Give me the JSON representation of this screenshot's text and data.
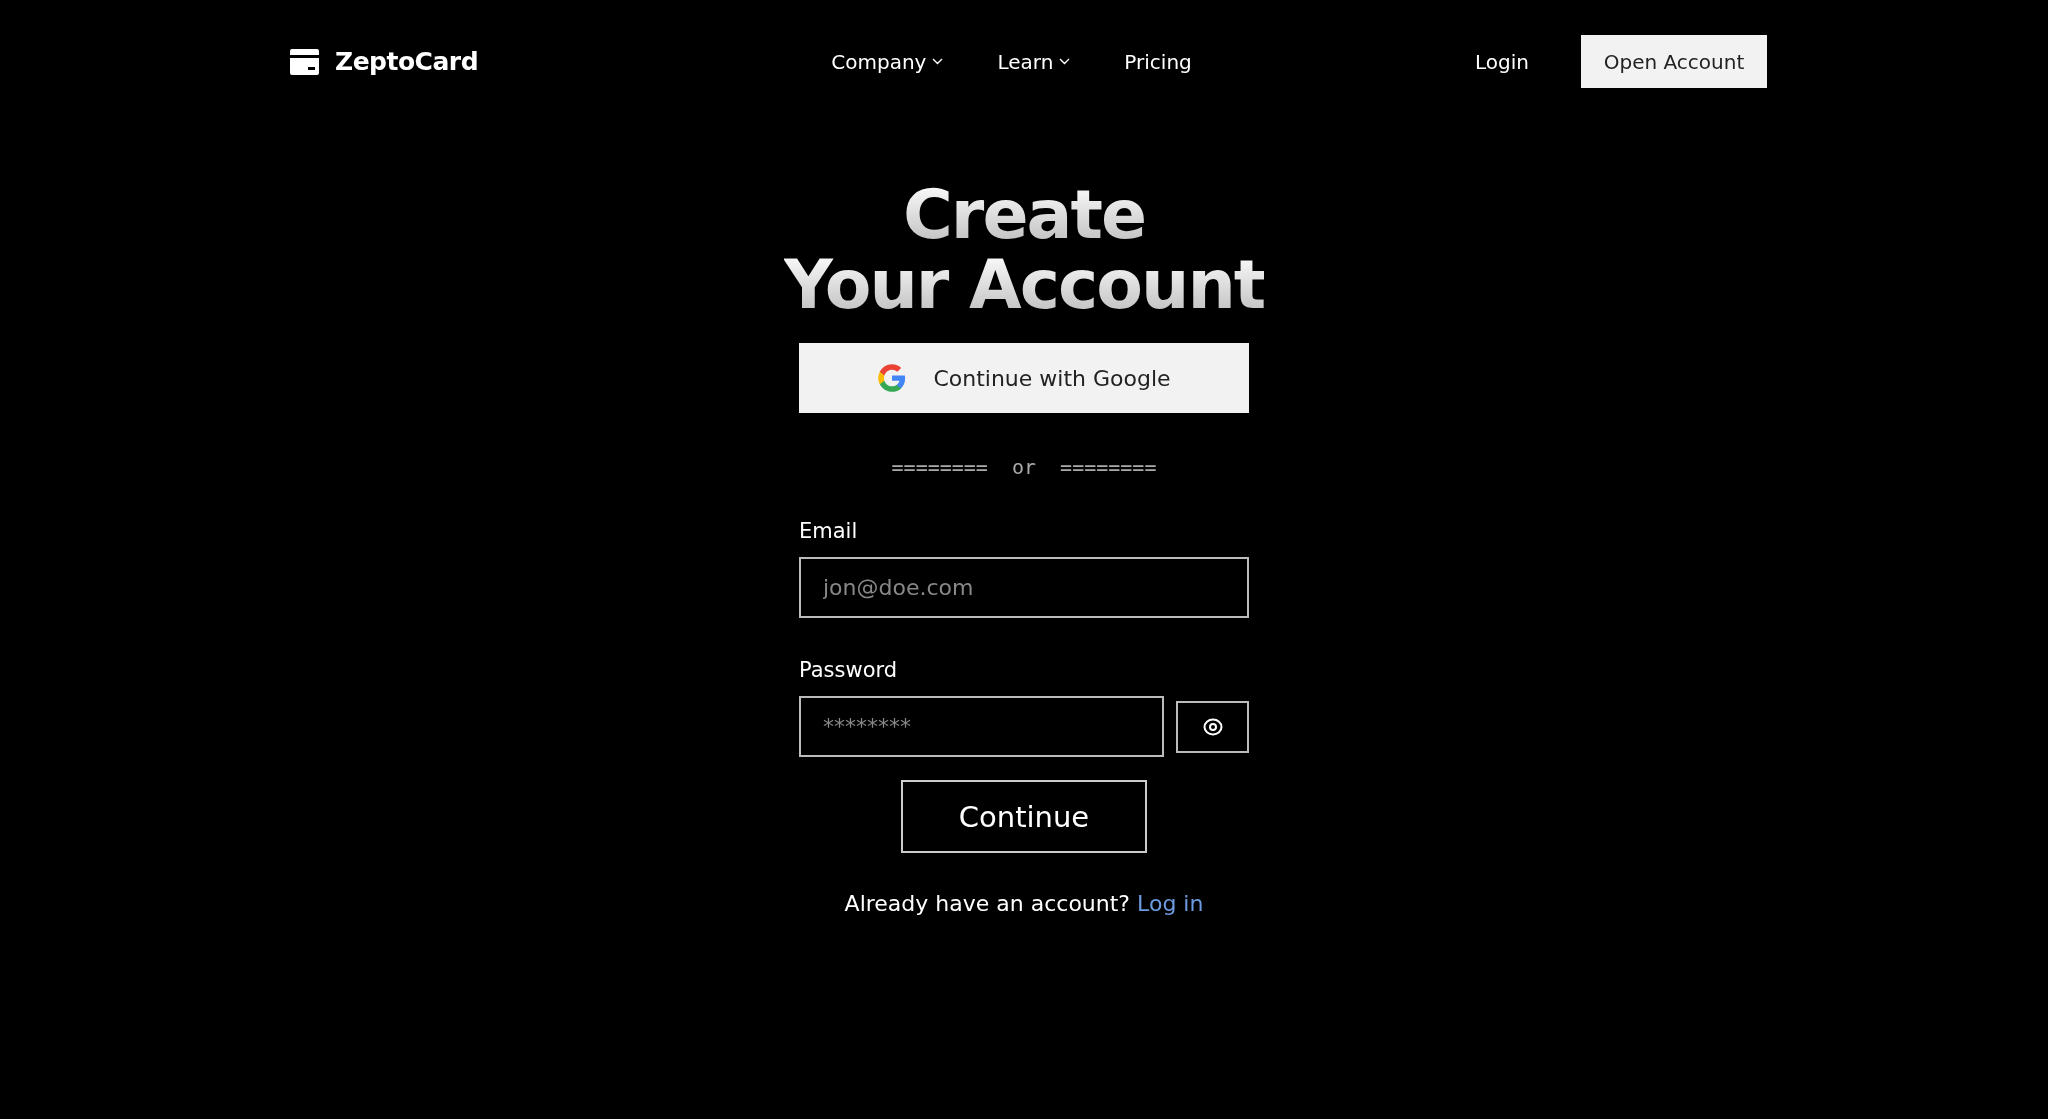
{
  "brand": {
    "name": "ZeptoCard"
  },
  "nav": [
    {
      "label": "Company",
      "kind": "dropdown"
    },
    {
      "label": "Learn",
      "kind": "dropdown"
    },
    {
      "label": "Pricing",
      "kind": "link"
    }
  ],
  "header_actions": {
    "login": "Login",
    "open_account": "Open Account"
  },
  "title_lines": [
    "Create",
    "Your Account"
  ],
  "google_button": "Continue with Google",
  "divider": "========  or  ========",
  "email": {
    "label": "Email",
    "placeholder": "jon@doe.com"
  },
  "password": {
    "label": "Password",
    "placeholder": "********"
  },
  "continue_button": "Continue",
  "footer": {
    "text": "Already have an account?",
    "link": "Log in"
  }
}
